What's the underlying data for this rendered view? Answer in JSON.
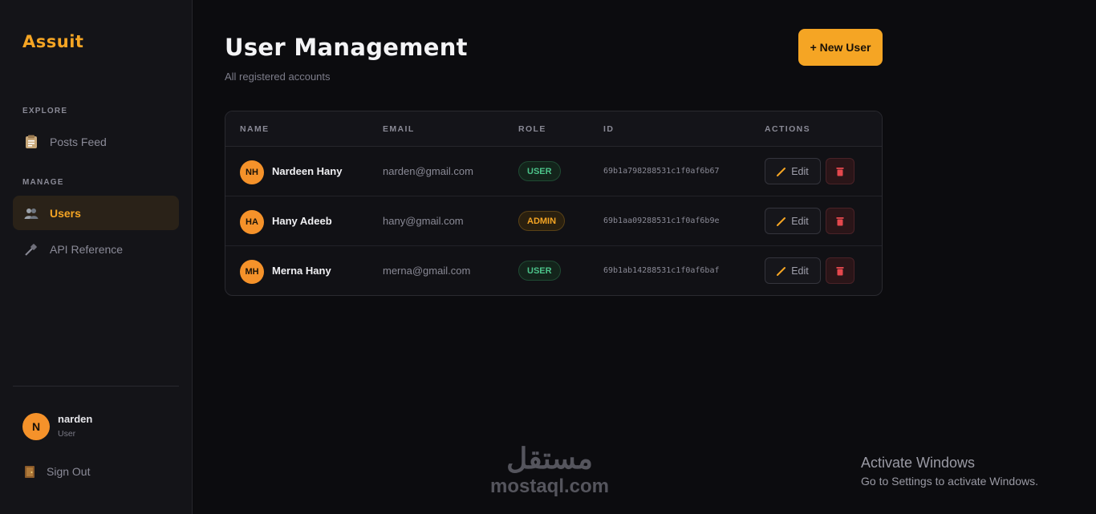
{
  "app": {
    "logo": "Assuit"
  },
  "sidebar": {
    "sections": [
      {
        "label": "EXPLORE"
      },
      {
        "label": "MANAGE"
      }
    ],
    "items": [
      {
        "label": "Posts Feed",
        "icon": "clipboard-icon",
        "active": false
      },
      {
        "label": "Users",
        "icon": "users-icon",
        "active": true
      },
      {
        "label": "API Reference",
        "icon": "plug-icon",
        "active": false
      }
    ],
    "profile": {
      "initial": "N",
      "name": "narden",
      "role": "User"
    },
    "signout_label": "Sign Out"
  },
  "page": {
    "title": "User Management",
    "subtitle": "All registered accounts",
    "new_user_label": "+ New User"
  },
  "table": {
    "headers": [
      "NAME",
      "EMAIL",
      "ROLE",
      "ID",
      "ACTIONS"
    ],
    "rows": [
      {
        "initials": "NH",
        "name": "Nardeen Hany",
        "email": "narden@gmail.com",
        "role": "USER",
        "id": "69b1a798288531c1f0af6b67",
        "edit": "Edit"
      },
      {
        "initials": "HA",
        "name": "Hany Adeeb",
        "email": "hany@gmail.com",
        "role": "ADMIN",
        "id": "69b1aa09288531c1f0af6b9e",
        "edit": "Edit"
      },
      {
        "initials": "MH",
        "name": "Merna Hany",
        "email": "merna@gmail.com",
        "role": "USER",
        "id": "69b1ab14288531c1f0af6baf",
        "edit": "Edit"
      }
    ]
  },
  "watermark": {
    "arabic": "مستقل",
    "latin": "mostaql.com"
  },
  "windows_notice": {
    "title": "Activate Windows",
    "subtitle": "Go to Settings to activate Windows."
  },
  "colors": {
    "accent": "#f5a524",
    "background": "#0c0c0f",
    "sidebar": "#141418",
    "user_badge": "#4cc38a",
    "danger": "#e5484d"
  }
}
